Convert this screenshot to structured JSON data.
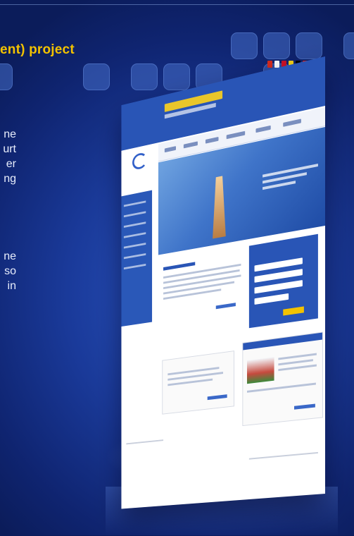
{
  "header": {
    "title": "ent) project"
  },
  "intro": {
    "line1": "ne",
    "line2": "urt",
    "line3": "er",
    "line4": "ng"
  },
  "body": {
    "line1": "ne",
    "line2": "so",
    "line3": "in"
  },
  "colors": {
    "background": "#1a3a9a",
    "accent": "#f2c200",
    "site_blue": "#2955b6"
  }
}
